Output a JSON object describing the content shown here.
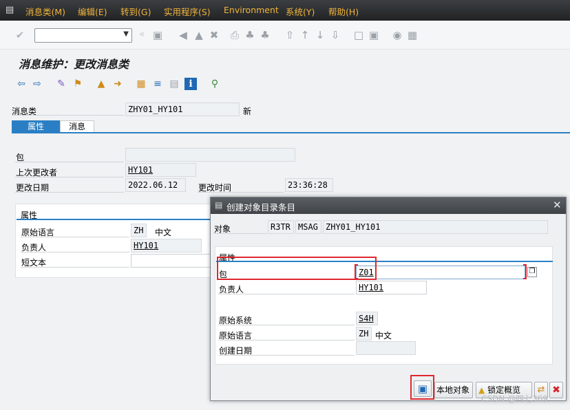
{
  "menu": [
    "消息类(M)",
    "编辑(E)",
    "转到(G)",
    "实用程序(S)",
    "Environment",
    "系统(Y)",
    "帮助(H)"
  ],
  "screen": {
    "title": "消息维护：更改消息类"
  },
  "header": {
    "msgclass_label": "消息类",
    "msgclass_value": "ZHY01_HY101",
    "status": "新"
  },
  "tabs": {
    "attributes": "属性",
    "messages": "消息"
  },
  "form": {
    "package_label": "包",
    "package_value": "",
    "last_changed_by_label": "上次更改者",
    "last_changed_by_value": "HY101",
    "changed_on_label": "更改日期",
    "changed_on_value": "2022.06.12",
    "changed_time_label": "更改时间",
    "changed_time_value": "23:36:28"
  },
  "attr_panel": {
    "title": "属性",
    "orig_lang_label": "原始语言",
    "orig_lang_code": "ZH",
    "orig_lang_name": "中文",
    "responsible_label": "负责人",
    "responsible_value": "HY101",
    "short_text_label": "短文本",
    "short_text_value": ""
  },
  "dialog": {
    "title": "创建对象目录条目",
    "object_label": "对象",
    "object_pgmid": "R3TR",
    "object_type": "MSAG",
    "object_name": "ZHY01_HY101",
    "group_title": "属性",
    "package_label": "包",
    "package_value": "Z01",
    "responsible_label": "负责人",
    "responsible_value": "HY101",
    "orig_system_label": "原始系统",
    "orig_system_value": "S4H",
    "orig_lang_label": "原始语言",
    "orig_lang_code": "ZH",
    "orig_lang_name": "中文",
    "created_on_label": "创建日期",
    "created_on_value": "",
    "btn_local_object": "本地对象",
    "btn_lock_overview": "锁定概览"
  },
  "watermark": "CSDN @四七369",
  "colors": {
    "menu_text": "#f2b43a",
    "accent_blue": "#2a7fc4",
    "highlight_red": "#e0262e"
  }
}
